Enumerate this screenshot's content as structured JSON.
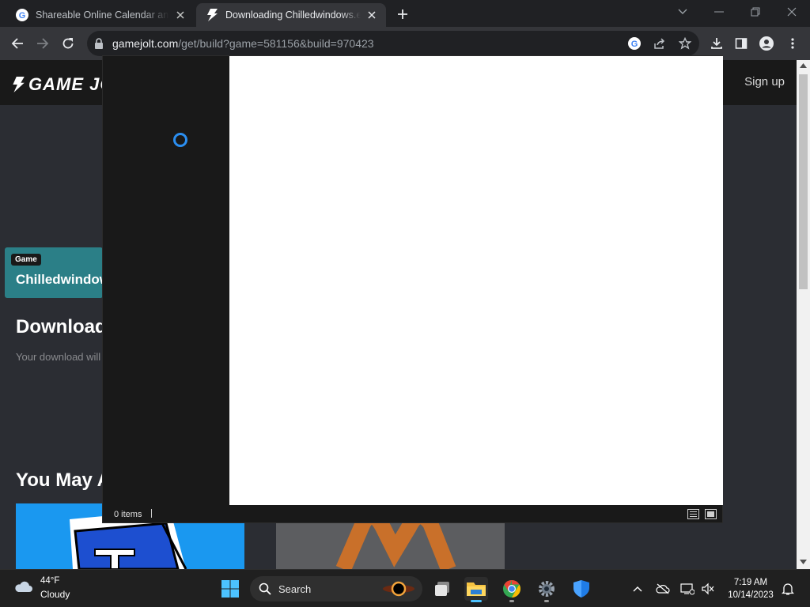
{
  "browser": {
    "tabs": [
      {
        "title": "Shareable Online Calendar and Scheduling",
        "favicon": "google-icon"
      },
      {
        "title": "Downloading Chilledwindows.exe",
        "favicon": "gamejolt-icon"
      }
    ],
    "url_host": "gamejolt.com",
    "url_path": "/get/build?game=581156&build=970423"
  },
  "site": {
    "logo_text": "GAME JOLT",
    "signup_label": "Sign up",
    "game_tag": "Game",
    "game_title": "Chilledwindows",
    "download_heading": "Download",
    "download_sub": "Your download will",
    "may_heading": "You May Also Like"
  },
  "dialog": {
    "status_items": "0 items"
  },
  "taskbar": {
    "weather_temp": "44°F",
    "weather_cond": "Cloudy",
    "search_label": "Search",
    "time": "7:19 AM",
    "date": "10/14/2023"
  },
  "colors": {
    "accent_green": "#ccff00",
    "spinner_blue": "#2b8ef0",
    "windows_blue": "#4cc2ff"
  }
}
